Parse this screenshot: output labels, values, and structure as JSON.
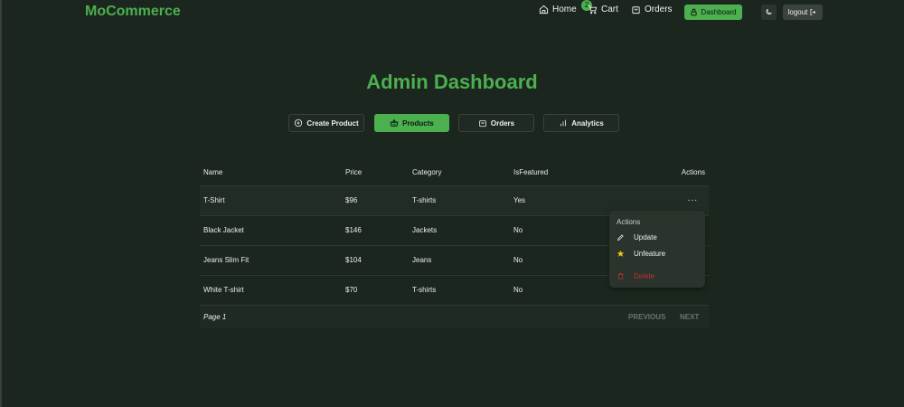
{
  "header": {
    "brand": "MoCommerce",
    "nav": {
      "home": "Home",
      "cart": "Cart",
      "cart_count": "2",
      "orders": "Orders",
      "dashboard": "Dashboard",
      "logout": "logout"
    }
  },
  "page": {
    "title": "Admin Dashboard",
    "tabs": {
      "create": "Create Product",
      "products": "Products",
      "orders": "Orders",
      "analytics": "Analytics"
    }
  },
  "table": {
    "headers": {
      "name": "Name",
      "price": "Price",
      "category": "Category",
      "featured": "IsFeatured",
      "actions": "Actions"
    },
    "rows": [
      {
        "name": "T-Shirt",
        "price": "$96",
        "category": "T-shirts",
        "featured": "Yes"
      },
      {
        "name": "Black Jacket",
        "price": "$146",
        "category": "Jackets",
        "featured": "No"
      },
      {
        "name": "Jeans Slim Fit",
        "price": "$104",
        "category": "Jeans",
        "featured": "No"
      },
      {
        "name": "White T-shirt",
        "price": "$70",
        "category": "T-shirts",
        "featured": "No"
      }
    ],
    "actions_icon": "...",
    "pagination": {
      "page": "Page 1",
      "previous": "PREVIOUS",
      "next": "NEXT"
    }
  },
  "menu": {
    "heading": "Actions",
    "update": "Update",
    "unfeature": "Unfeature",
    "delete": "Delete"
  },
  "colors": {
    "accent": "#4caf50",
    "background": "#1b271e",
    "danger": "#c03030"
  }
}
